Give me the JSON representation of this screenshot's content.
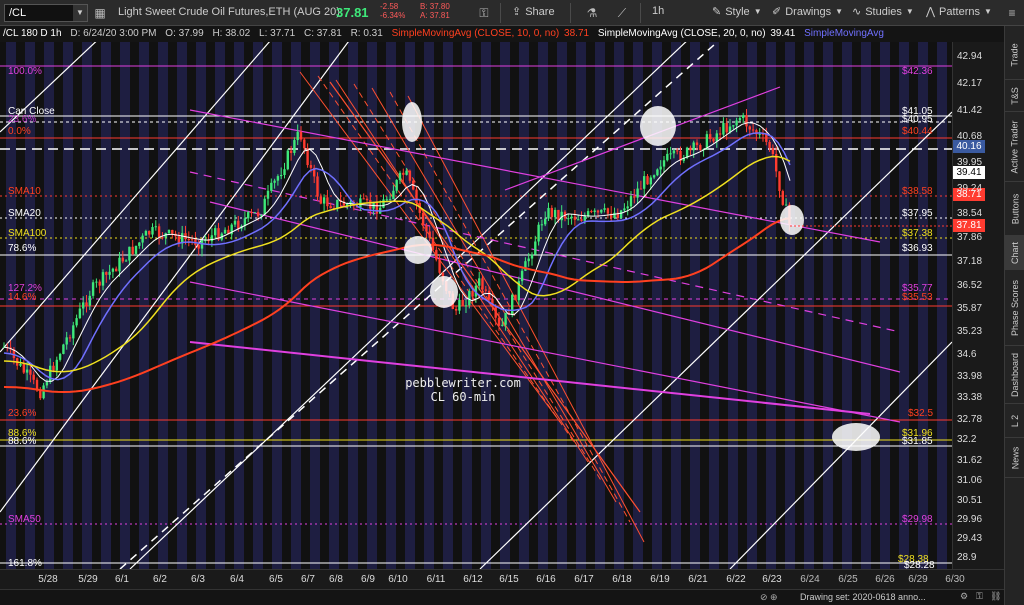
{
  "toolbar": {
    "symbol": "/CL",
    "description": "Light Sweet Crude Oil Futures,ETH (AUG 20)",
    "last": "37.81",
    "change": "-2.58",
    "change_pct": "-6.34%",
    "bid": "B: 37.80",
    "ask": "A: 37.81",
    "share": "Share",
    "timeframe": "1h",
    "style": "Style",
    "drawings": "Drawings",
    "studies": "Studies",
    "patterns": "Patterns"
  },
  "legend": {
    "header": "/CL 180 D 1h",
    "date": "D: 6/24/20 3:00 PM",
    "open": "O: 37.99",
    "high": "H: 38.02",
    "low": "L: 37.71",
    "close": "C: 37.81",
    "range": "R: 0.31",
    "sma10": "SimpleMovingAvg (CLOSE, 10, 0, no)",
    "sma10_val": "38.71",
    "sma20": "SimpleMovingAvg (CLOSE, 20, 0, no)",
    "sma20_val": "39.41",
    "sma_next": "SimpleMovingAvg"
  },
  "chart_levels": {
    "pct100": "100.0%",
    "can_close": "Can Close",
    "pct_under": "23.6%",
    "pct0": "0.0%",
    "sma10_label": "SMA10",
    "sma20_label": "SMA20",
    "sma100_label": "SMA100",
    "pct786": "78.6%",
    "pct1272": "127.2%",
    "pct146": "14.6%",
    "pct236": "23.6%",
    "pct886": "88.6%",
    "pct886b": "88.6%",
    "sma50_label": "SMA50",
    "pct1618": "161.8%"
  },
  "price_labels": {
    "p4236": "$42.36",
    "p4105": "$41.05",
    "p4095": "$40.95",
    "p4044": "$40.44",
    "p3858": "$38.58",
    "p3795": "$37.95",
    "p3738": "$37.38",
    "p3693": "$36.93",
    "p3577": "$35.77",
    "p3553": "$35.53",
    "p325": "$32.5",
    "p3196": "$31.96",
    "p3185": "$31.85",
    "p2998": "$29.98",
    "p2838": "$28.38",
    "p2828": "$28.28"
  },
  "watermark": {
    "line1": "pebblewriter.com",
    "line2": "CL 60-min"
  },
  "yaxis": {
    "ticks": [
      "42.94",
      "42.17",
      "41.42",
      "40.68",
      "39.95",
      "39.24",
      "38.54",
      "37.86",
      "37.18",
      "36.52",
      "35.87",
      "35.23",
      "34.6",
      "33.98",
      "33.38",
      "32.78",
      "32.2",
      "31.62",
      "31.06",
      "30.51",
      "29.96",
      "29.43",
      "28.9"
    ],
    "badges": {
      "b4016": "40.16",
      "b3941": "39.41",
      "b3871": "38.71",
      "b3781": "37.81"
    }
  },
  "xaxis": {
    "ticks": [
      "5/28",
      "5/29",
      "6/1",
      "6/2",
      "6/3",
      "6/4",
      "6/5",
      "6/7",
      "6/8",
      "6/9",
      "6/10",
      "6/11",
      "6/12",
      "6/15",
      "6/16",
      "6/17",
      "6/18",
      "6/19",
      "6/21",
      "6/22",
      "6/23",
      "6/24",
      "6/25",
      "6/26",
      "6/29",
      "6/30"
    ]
  },
  "status": {
    "drawing_set": "Drawing set: 2020-0618 anno..."
  },
  "sidepanel": {
    "tabs": [
      "Trade",
      "T&S",
      "Active Trader",
      "Buttons",
      "Chart",
      "Phase Scores",
      "Dashboard",
      "L 2",
      "News"
    ]
  },
  "colors": {
    "up": "#3ee87a",
    "down": "#ff3b30",
    "magenta": "#e040e0",
    "sma10": "#ff4020",
    "sma20": "#ffffff",
    "sma50": "#7070ff",
    "sma100": "#f0e020",
    "grid_band": "#2a2a6a"
  }
}
